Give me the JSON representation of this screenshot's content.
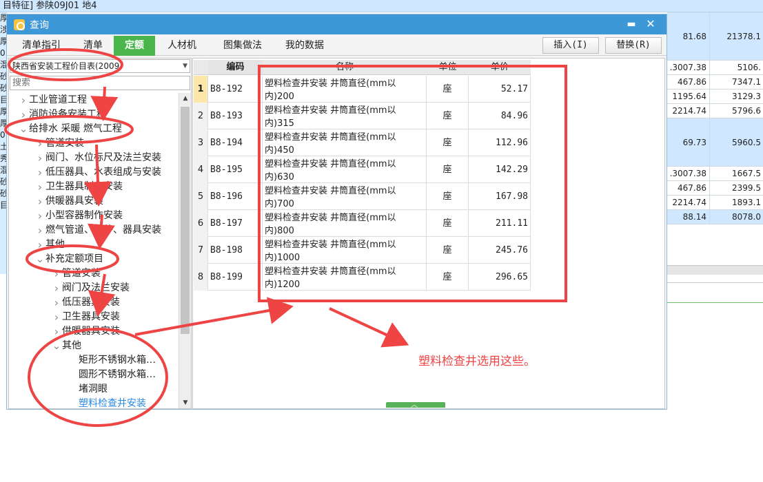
{
  "background": {
    "top_row_text": "目特征]  参陕09J01 地4",
    "left_strip_chars": [
      "厚",
      "涉",
      "厚",
      "0",
      "混",
      "砂",
      "砂",
      "目",
      "厚",
      "厚",
      "0",
      "土",
      "秀",
      "混",
      "砂",
      "砂",
      "目"
    ],
    "rows": [
      {
        "a": "81.68",
        "b": "21378.1",
        "highlight": true,
        "tall": true
      },
      {
        "a": ".3007.38",
        "b": "5106.",
        "highlight": false
      },
      {
        "a": "467.86",
        "b": "7347.1",
        "highlight": false
      },
      {
        "a": "1195.64",
        "b": "3129.3",
        "highlight": false
      },
      {
        "a": "2214.74",
        "b": "5796.6",
        "highlight": false
      },
      {
        "a": "69.73",
        "b": "5960.5",
        "highlight": true,
        "tall": true
      },
      {
        "a": ".3007.38",
        "b": "1667.5",
        "highlight": false
      },
      {
        "a": "467.86",
        "b": "2399.5",
        "highlight": false
      },
      {
        "a": "2214.74",
        "b": "1893.1",
        "highlight": false
      },
      {
        "a": "88.14",
        "b": "8078.0",
        "highlight": true
      }
    ]
  },
  "dialog": {
    "title": "查询",
    "min_glyph": "▬",
    "close_glyph": "✕",
    "tabs": [
      {
        "label": "清单指引",
        "active": false
      },
      {
        "label": "清单",
        "active": false
      },
      {
        "label": "定额",
        "active": true
      },
      {
        "label": "人材机",
        "active": false
      },
      {
        "label": "图集做法",
        "active": false
      },
      {
        "label": "我的数据",
        "active": false
      }
    ],
    "insert_button": "插入(I)",
    "replace_button": "替换(R)",
    "library_select": "陕西省安装工程价目表(2009",
    "search_placeholder": "搜索",
    "tree": [
      {
        "label": "工业管道工程",
        "level": 0,
        "expanded": false
      },
      {
        "label": "消防设备安装工程",
        "level": 0,
        "expanded": false
      },
      {
        "label": "给排水 采暖 燃气工程",
        "level": 0,
        "expanded": true
      },
      {
        "label": "管道安装",
        "level": 1,
        "expanded": false
      },
      {
        "label": "阀门、水位标尺及法兰安装",
        "level": 1,
        "expanded": false
      },
      {
        "label": "低压器具、水表组成与安装",
        "level": 1,
        "expanded": false
      },
      {
        "label": "卫生器具制作安装",
        "level": 1,
        "expanded": false
      },
      {
        "label": "供暖器具安装",
        "level": 1,
        "expanded": false
      },
      {
        "label": "小型容器制作安装",
        "level": 1,
        "expanded": false
      },
      {
        "label": "燃气管道、附件、器具安装",
        "level": 1,
        "expanded": false
      },
      {
        "label": "其他",
        "level": 1,
        "expanded": false
      },
      {
        "label": "补充定额项目",
        "level": 1,
        "expanded": true
      },
      {
        "label": "管道安装",
        "level": 2,
        "expanded": false
      },
      {
        "label": "阀门及法兰安装",
        "level": 2,
        "expanded": false
      },
      {
        "label": "低压器具安装",
        "level": 2,
        "expanded": false
      },
      {
        "label": "卫生器具安装",
        "level": 2,
        "expanded": false
      },
      {
        "label": "供暖器具安装",
        "level": 2,
        "expanded": false
      },
      {
        "label": "其他",
        "level": 2,
        "expanded": true
      },
      {
        "label": "矩形不锈钢水箱…",
        "level": 3,
        "leaf": true
      },
      {
        "label": "圆形不锈钢水箱…",
        "level": 3,
        "leaf": true
      },
      {
        "label": "堵洞眼",
        "level": 3,
        "leaf": true
      },
      {
        "label": "塑料检查井安装",
        "level": 3,
        "leaf": true,
        "link": true
      }
    ],
    "grid": {
      "headers": {
        "code": "编码",
        "name": "名称",
        "unit": "单位",
        "price": "单价"
      },
      "rows": [
        {
          "num": "1",
          "code": "B8-192",
          "name": "塑料检查井安装 井筒直径(mm以内)200",
          "unit": "座",
          "price": "52.17",
          "selected": true
        },
        {
          "num": "2",
          "code": "B8-193",
          "name": "塑料检查井安装 井筒直径(mm以内)315",
          "unit": "座",
          "price": "84.96"
        },
        {
          "num": "3",
          "code": "B8-194",
          "name": "塑料检查井安装 井筒直径(mm以内)450",
          "unit": "座",
          "price": "112.96"
        },
        {
          "num": "4",
          "code": "B8-195",
          "name": "塑料检查井安装 井筒直径(mm以内)630",
          "unit": "座",
          "price": "142.29"
        },
        {
          "num": "5",
          "code": "B8-196",
          "name": "塑料检查井安装 井筒直径(mm以内)700",
          "unit": "座",
          "price": "167.98"
        },
        {
          "num": "6",
          "code": "B8-197",
          "name": "塑料检查井安装 井筒直径(mm以内)800",
          "unit": "座",
          "price": "211.11"
        },
        {
          "num": "7",
          "code": "B8-198",
          "name": "塑料检查井安装 井筒直径(mm以内)1000",
          "unit": "座",
          "price": "245.76"
        },
        {
          "num": "8",
          "code": "B8-199",
          "name": "塑料检查井安装 井筒直径(mm以内)1200",
          "unit": "座",
          "price": "296.65"
        }
      ]
    }
  },
  "annotation": {
    "text": "塑料检查井选用这些。",
    "color": "#ee4444"
  }
}
